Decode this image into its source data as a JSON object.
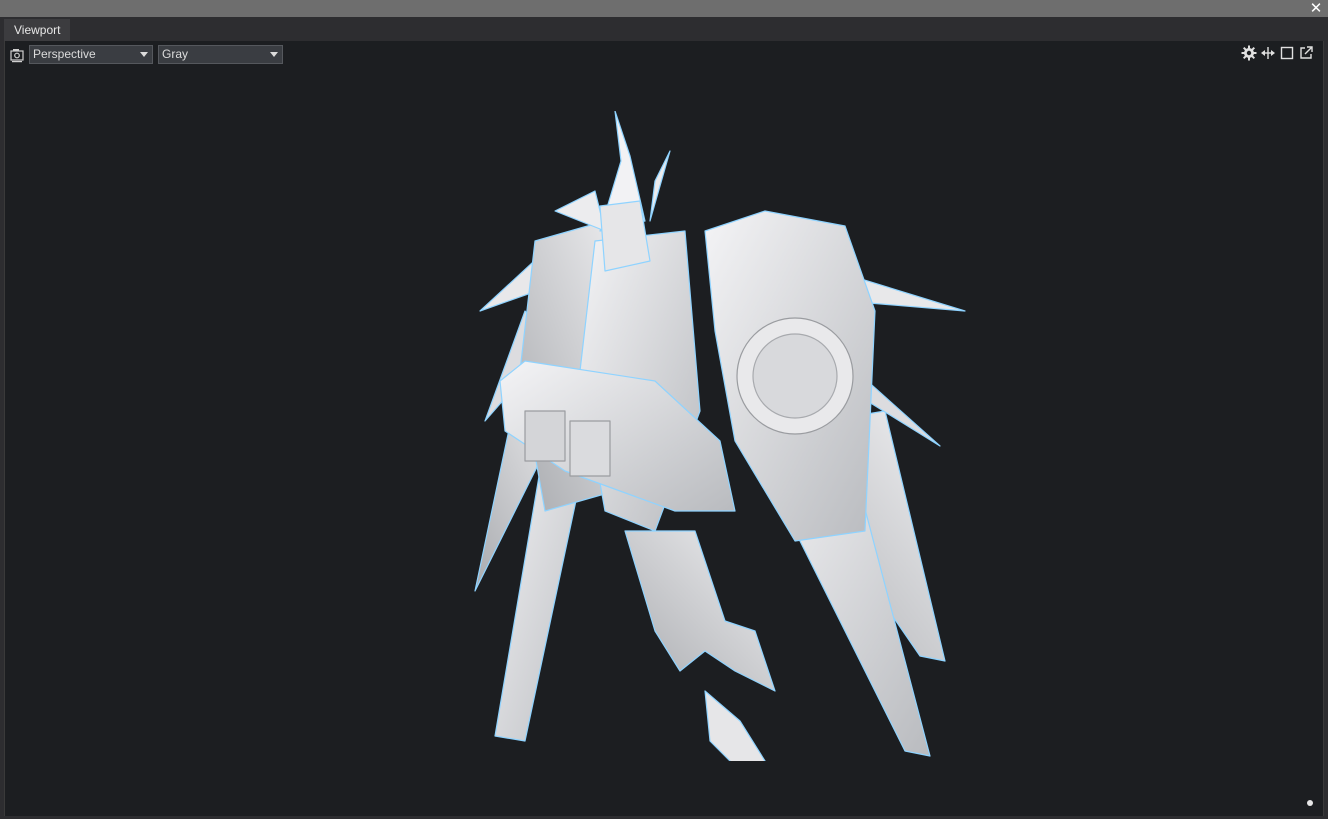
{
  "window": {
    "close_glyph": "✕",
    "tab_label": "Viewport"
  },
  "toolbar": {
    "camera_icon": "camera-icon",
    "projection": {
      "selected": "Perspective"
    },
    "shading": {
      "selected": "Gray"
    },
    "right_icons": [
      "gear-icon",
      "pan-arrows-icon",
      "maximize-icon",
      "pop-out-icon"
    ]
  },
  "viewport": {
    "background_color": "#1c1e21",
    "model_color": "#e4e4e6",
    "rim_color": "#8fd3ff"
  }
}
